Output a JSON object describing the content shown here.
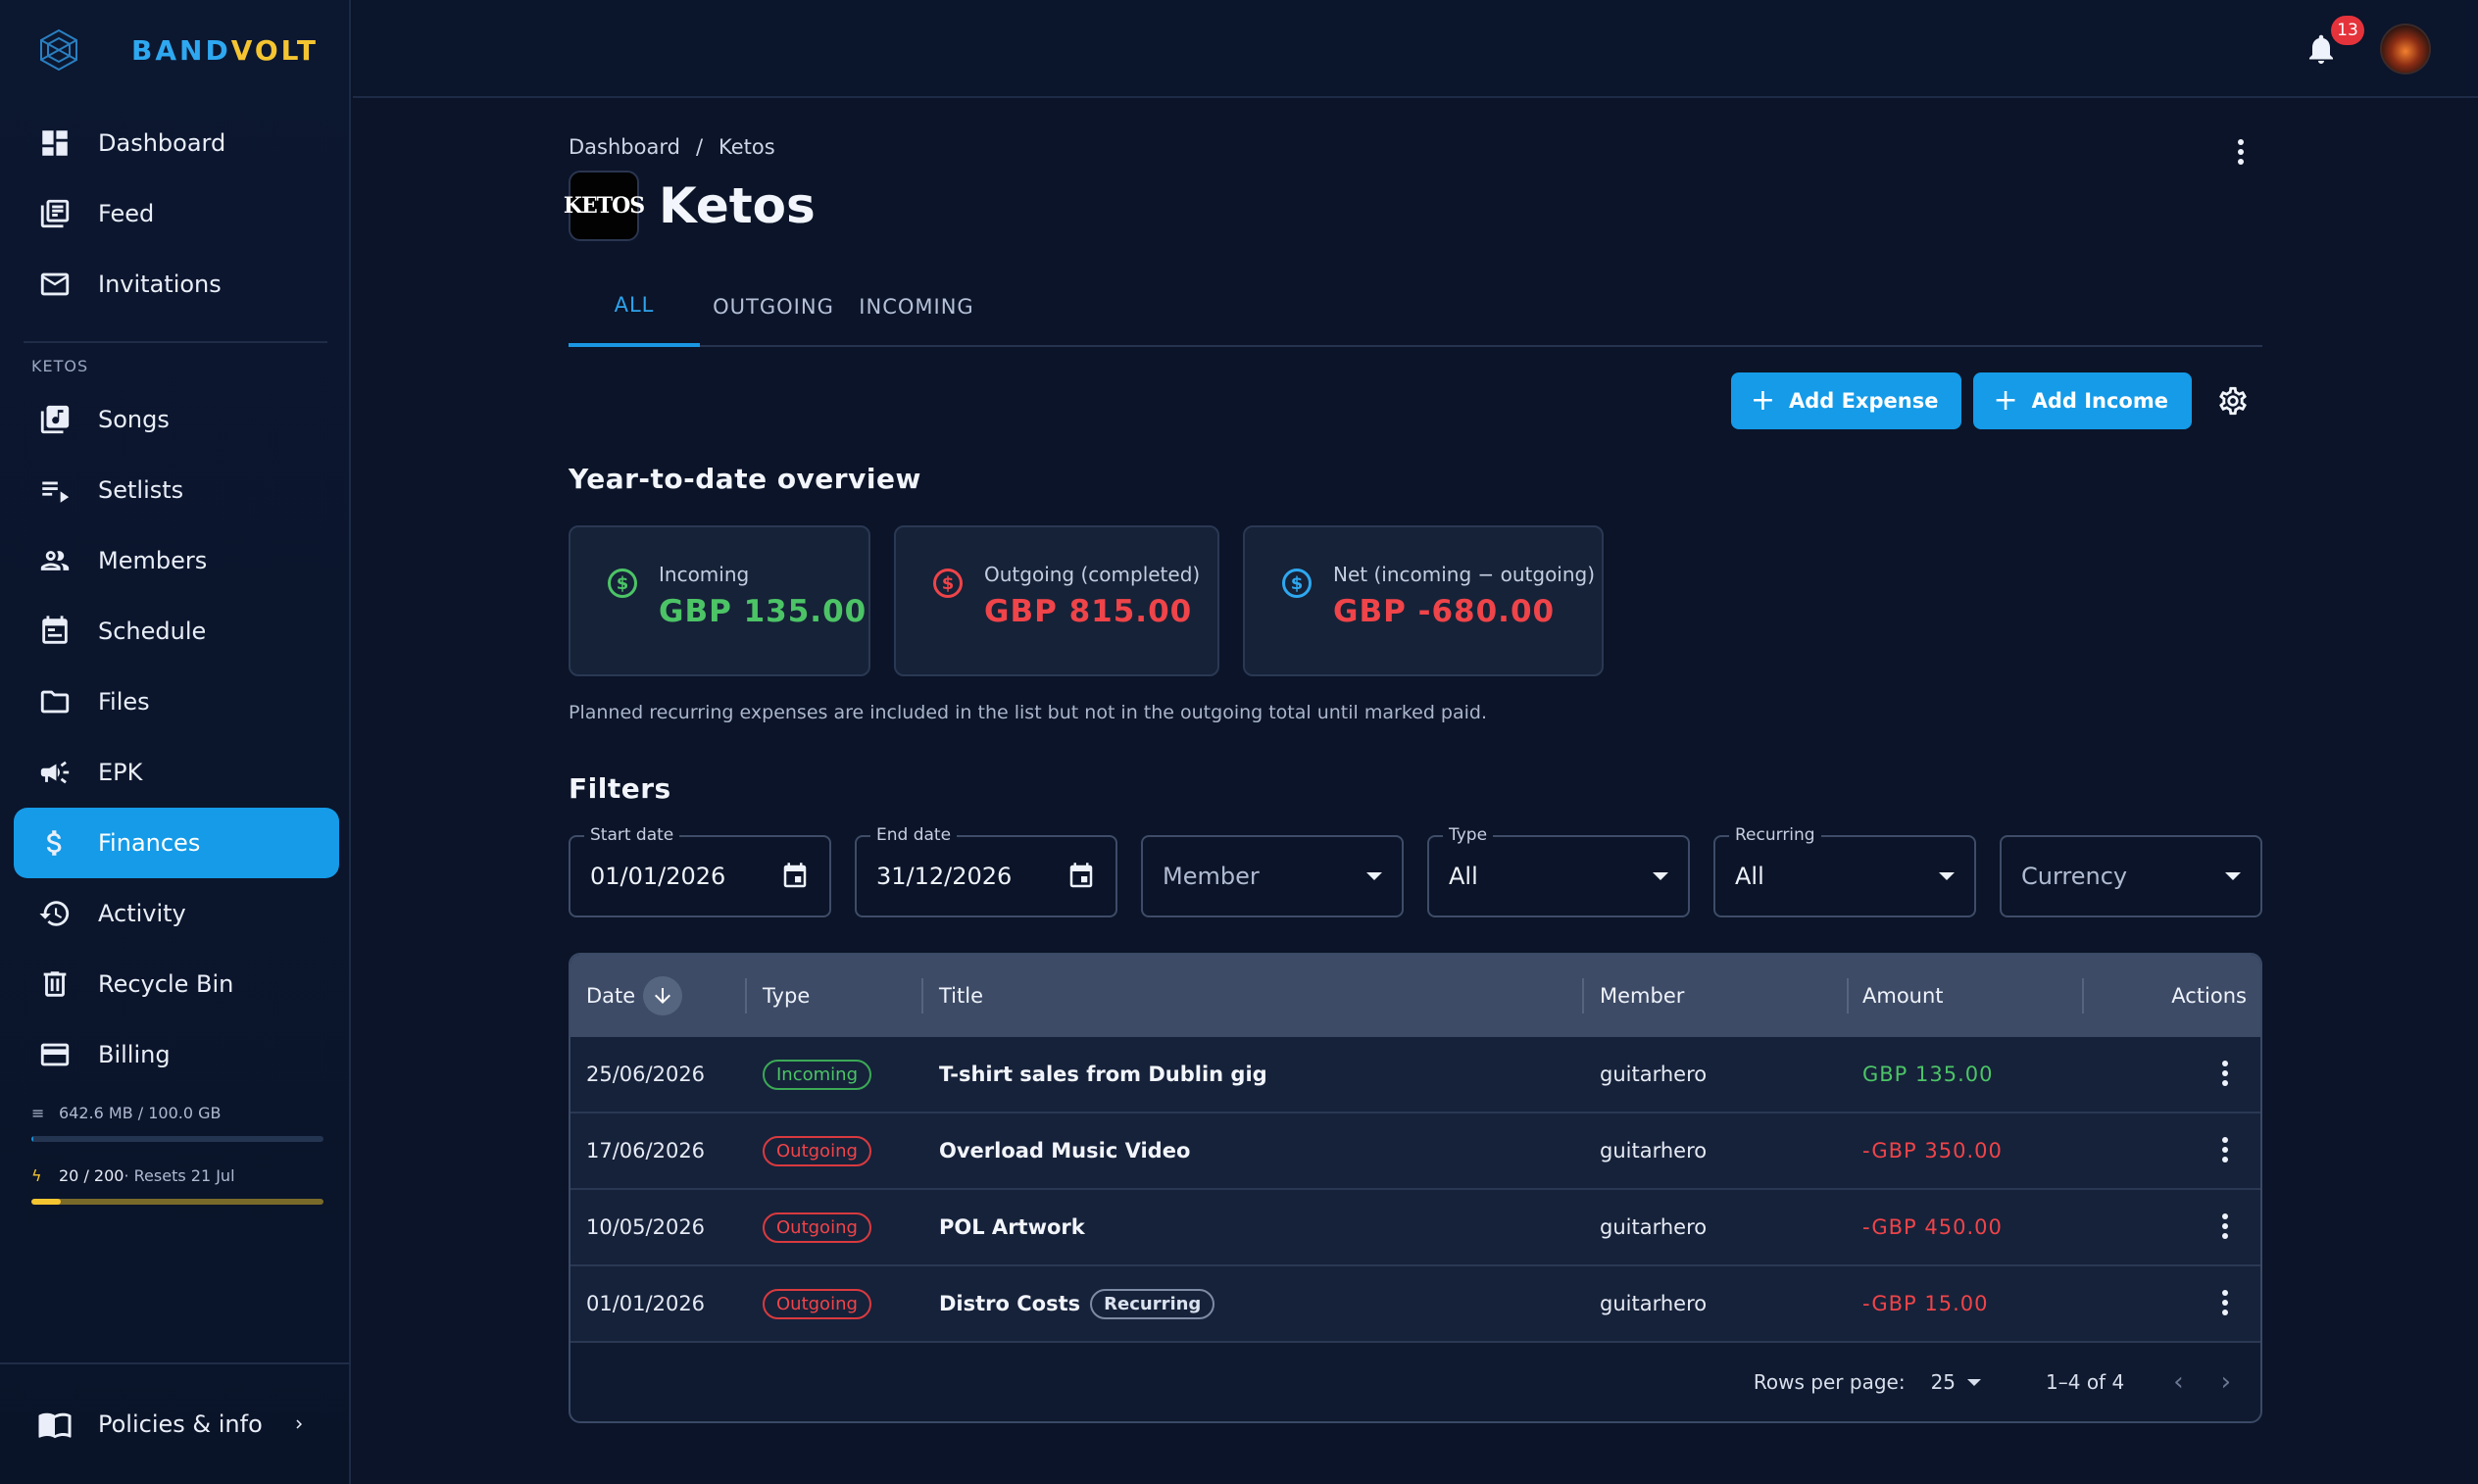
{
  "brand": {
    "part1": "BAND",
    "part2": "VOLT"
  },
  "sidebar": {
    "top_items": [
      {
        "label": "Dashboard",
        "icon": "dashboard-icon"
      },
      {
        "label": "Feed",
        "icon": "feed-icon"
      },
      {
        "label": "Invitations",
        "icon": "mail-icon"
      }
    ],
    "section_label": "KETOS",
    "band_items": [
      {
        "label": "Songs",
        "icon": "music-library-icon"
      },
      {
        "label": "Setlists",
        "icon": "playlist-icon"
      },
      {
        "label": "Members",
        "icon": "people-icon"
      },
      {
        "label": "Schedule",
        "icon": "calendar-icon"
      },
      {
        "label": "Files",
        "icon": "folder-icon"
      },
      {
        "label": "EPK",
        "icon": "megaphone-icon"
      },
      {
        "label": "Finances",
        "icon": "dollar-icon",
        "active": true
      },
      {
        "label": "Activity",
        "icon": "history-icon"
      },
      {
        "label": "Recycle Bin",
        "icon": "trash-icon"
      },
      {
        "label": "Billing",
        "icon": "credit-card-icon"
      }
    ],
    "storage": {
      "text": "642.6 MB / 100.0 GB",
      "fraction": 0.006
    },
    "credits": {
      "used": "20 / 200",
      "reset": " · Resets 21 Jul",
      "fraction": 0.1
    },
    "policies_label": "Policies & info"
  },
  "topbar": {
    "notification_count": "13"
  },
  "breadcrumb": {
    "root": "Dashboard",
    "sep": "/",
    "current": "Ketos"
  },
  "page": {
    "title": "Ketos",
    "logo_text": "KETOS"
  },
  "tabs": [
    "ALL",
    "OUTGOING",
    "INCOMING"
  ],
  "buttons": {
    "add_expense": "Add Expense",
    "add_income": "Add Income"
  },
  "overview": {
    "title": "Year-to-date overview",
    "cards": [
      {
        "label": "Incoming",
        "value": "GBP 135.00",
        "color": "#4cc466"
      },
      {
        "label": "Outgoing (completed)",
        "value": "GBP 815.00",
        "color": "#ef4449"
      },
      {
        "label": "Net (incoming − outgoing)",
        "value": "GBP -680.00",
        "color": "#ef4449",
        "icon_color": "#2ea8f0"
      }
    ],
    "note": "Planned recurring expenses are included in the list but not in the outgoing total until marked paid."
  },
  "filters": {
    "title": "Filters",
    "start_date": {
      "label": "Start date",
      "value": "01/01/2026"
    },
    "end_date": {
      "label": "End date",
      "value": "31/12/2026"
    },
    "member": {
      "placeholder": "Member"
    },
    "type": {
      "label": "Type",
      "value": "All"
    },
    "recurring": {
      "label": "Recurring",
      "value": "All"
    },
    "currency": {
      "placeholder": "Currency"
    }
  },
  "table": {
    "columns": {
      "date": "Date",
      "type": "Type",
      "title": "Title",
      "member": "Member",
      "amount": "Amount",
      "actions": "Actions"
    },
    "rows": [
      {
        "date": "25/06/2026",
        "type": "Incoming",
        "title": "T-shirt sales from Dublin gig",
        "member": "guitarhero",
        "amount": "GBP 135.00",
        "recurring": ""
      },
      {
        "date": "17/06/2026",
        "type": "Outgoing",
        "title": "Overload Music Video",
        "member": "guitarhero",
        "amount": "-GBP 350.00",
        "recurring": ""
      },
      {
        "date": "10/05/2026",
        "type": "Outgoing",
        "title": "POL Artwork",
        "member": "guitarhero",
        "amount": "-GBP 450.00",
        "recurring": ""
      },
      {
        "date": "01/01/2026",
        "type": "Outgoing",
        "title": "Distro Costs",
        "member": "guitarhero",
        "amount": "-GBP 15.00",
        "recurring": "Recurring"
      }
    ],
    "footer": {
      "rows_per_page_label": "Rows per page:",
      "rows_per_page": "25",
      "range": "1–4 of 4"
    }
  },
  "colors": {
    "accent": "#159be8",
    "income": "#4cc466",
    "outgoing": "#ef4449",
    "brand_yellow": "#f4c531"
  }
}
